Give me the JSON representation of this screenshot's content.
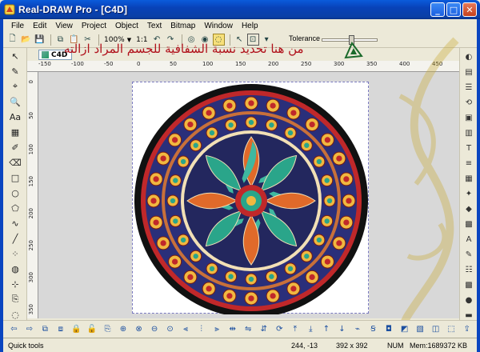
{
  "window": {
    "title": "Real-DRAW Pro - [C4D]",
    "min": "_",
    "max": "□",
    "close": "✕"
  },
  "menu": [
    "File",
    "Edit",
    "View",
    "Project",
    "Object",
    "Text",
    "Bitmap",
    "Window",
    "Help"
  ],
  "toolbar": {
    "zoom": "100%",
    "ratio": "1:1",
    "tolerance_label": "Tolerance",
    "tolerance_value": 0.5
  },
  "document": {
    "tab": "C4D"
  },
  "ruler": {
    "h_labels": [
      "-150",
      "-100",
      "-50",
      "0",
      "50",
      "100",
      "150",
      "200",
      "250",
      "300",
      "350",
      "400",
      "450"
    ],
    "v_labels": [
      "0",
      "50",
      "100",
      "150",
      "200",
      "250",
      "300",
      "350"
    ]
  },
  "overlay_text": "من هنا تحديد نسبة الشفافية للجسم المراد ازالته",
  "status": {
    "left": "Quick tools",
    "coords": "244, -13",
    "size": "392 x 392",
    "num": "NUM",
    "mem": "Mem:1689372 KB"
  },
  "colors": {
    "titlebar": "#0a45c0",
    "accent_red": "#b0101a",
    "mandala_navy": "#2a2f7a",
    "mandala_teal": "#2aa58a",
    "mandala_gold": "#f0b840",
    "mandala_red": "#c0282a"
  },
  "icons": {
    "left": [
      "arrow-icon",
      "pen-icon",
      "node-icon",
      "zoom-icon",
      "text-icon",
      "image-icon",
      "brush-icon",
      "eraser-icon",
      "rect-icon",
      "ellipse-icon",
      "polygon-icon",
      "curve-icon",
      "line-icon",
      "spray-icon",
      "fill-icon",
      "pick-icon",
      "clone-icon",
      "blur-icon",
      "lasso-icon",
      "crop-icon"
    ],
    "right": [
      "color-wheel-icon",
      "gradient-icon",
      "layers-icon",
      "history-icon",
      "palette-icon",
      "brush-preset-icon",
      "text-style-icon",
      "align-icon",
      "grid-icon",
      "effects-icon",
      "shape-icon",
      "texture-icon",
      "font-icon",
      "script-icon",
      "filter-icon",
      "color-grid-icon",
      "brush-size-icon",
      "stroke-icon",
      "fill-style-icon",
      "paste-icon"
    ],
    "bottom": [
      "back-icon",
      "forward-icon",
      "group-icon",
      "ungroup-icon",
      "lock-icon",
      "unlock-icon",
      "clone-icon",
      "combine-icon",
      "intersect-icon",
      "exclude-icon",
      "weld-icon",
      "align-left-icon",
      "align-center-icon",
      "align-right-icon",
      "distribute-icon",
      "flip-h-icon",
      "flip-v-icon",
      "rotate-icon",
      "to-front-icon",
      "to-back-icon",
      "forward-one-icon",
      "back-one-icon",
      "path-icon",
      "text-path-icon",
      "shadow-icon",
      "blend-icon",
      "mask-icon",
      "transparency-icon",
      "frame-icon",
      "export-icon"
    ]
  }
}
